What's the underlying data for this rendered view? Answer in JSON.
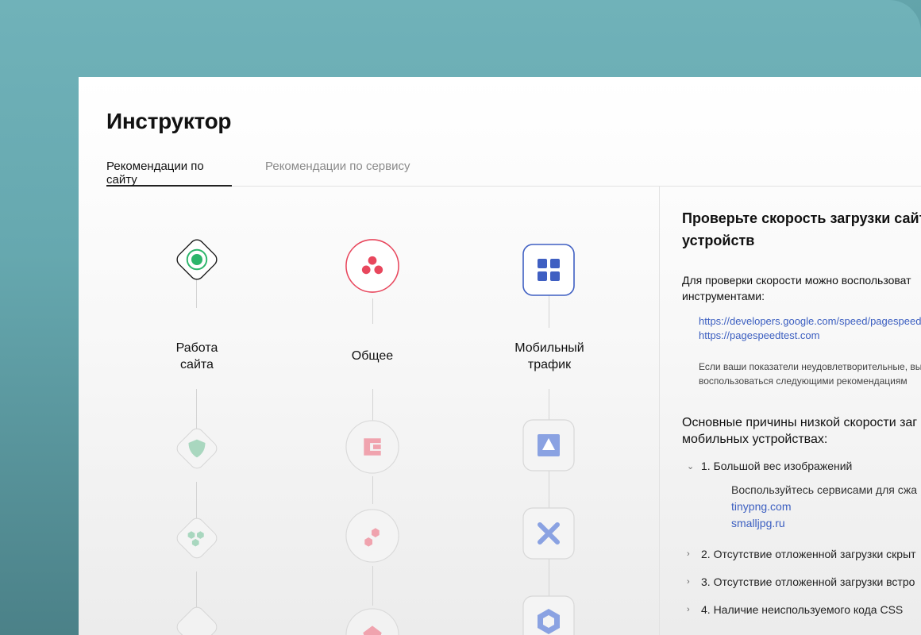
{
  "title": "Инструктор",
  "tabs": [
    {
      "label": "Рекомендации по сайту",
      "active": true
    },
    {
      "label": "Рекомендации по сервису",
      "active": false
    }
  ],
  "categories": [
    {
      "label_line1": "Работа",
      "label_line2": "сайта",
      "icon": "target-icon",
      "color": "#2bb56a"
    },
    {
      "label_line1": "Общее",
      "label_line2": "",
      "icon": "three-dots-icon",
      "color": "#e8475d"
    },
    {
      "label_line1": "Мобильный",
      "label_line2": "трафик",
      "icon": "grid-icon",
      "color": "#3f5fc2"
    }
  ],
  "secondary_icons": {
    "col1": [
      "shield-icon",
      "hexagons-icon"
    ],
    "col2": [
      "bracket-icon",
      "hexagon-pair-icon"
    ],
    "col3": [
      "triangle-icon",
      "cross-icon",
      "hexagon-icon"
    ]
  },
  "detail": {
    "heading_line1": "Проверьте скорость загрузки сайта",
    "heading_line2": "устройств",
    "intro_line1": "Для проверки скорости можно воспользоват",
    "intro_line2": "инструментами:",
    "links": [
      "https://developers.google.com/speed/pagespeed/in",
      "https://pagespeedtest.com"
    ],
    "note_line1": "Если ваши показатели неудовлетворительные, вы",
    "note_line2": "воспользоваться следующими рекомендациям",
    "causes_line1": "Основные причины низкой скорости заг",
    "causes_line2": "мобильных устройствах:",
    "accordion": [
      {
        "label": "1. Большой вес изображений",
        "expanded": true
      },
      {
        "label": "2. Отсутствие отложенной загрузки скрыт",
        "expanded": false
      },
      {
        "label": "3. Отсутствие отложенной загрузки встро",
        "expanded": false
      },
      {
        "label": "4. Наличие неиспользуемого кода CSS",
        "expanded": false
      }
    ],
    "accordion_body": {
      "text": "Воспользуйтесь сервисами для сжа",
      "links": [
        "tinypng.com",
        "smalljpg.ru"
      ]
    }
  }
}
